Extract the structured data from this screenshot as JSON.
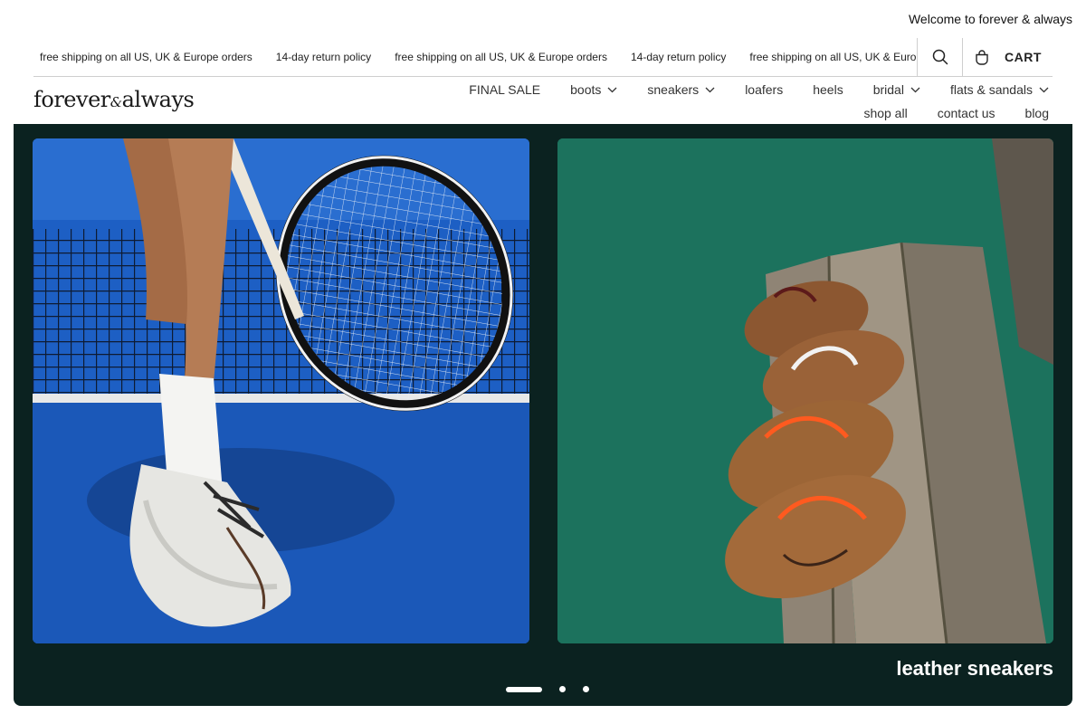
{
  "welcome": "Welcome to forever & always",
  "ticker": [
    "free shipping on all US, UK & Europe orders",
    "14-day return policy",
    "free shipping on all US, UK & Europe orders",
    "14-day return policy",
    "free shipping on all US, UK & Europe orders"
  ],
  "cart": {
    "label": "CART"
  },
  "logo": {
    "part1": "forever",
    "amp": "&",
    "part2": "always"
  },
  "nav": {
    "row1": [
      {
        "label": "FINAL SALE",
        "dropdown": false
      },
      {
        "label": "boots",
        "dropdown": true
      },
      {
        "label": "sneakers",
        "dropdown": true
      },
      {
        "label": "loafers",
        "dropdown": false
      },
      {
        "label": "heels",
        "dropdown": false
      },
      {
        "label": "bridal",
        "dropdown": true
      },
      {
        "label": "flats & sandals",
        "dropdown": true
      }
    ],
    "row2": [
      {
        "label": "shop all"
      },
      {
        "label": "contact us"
      },
      {
        "label": "blog"
      }
    ]
  },
  "hero": {
    "caption": "leather sneakers",
    "slide_count": 3,
    "active_slide": 1
  },
  "colors": {
    "hero_bg": "#0b2220",
    "court_blue": "#1f63c6",
    "court_green": "#1e7a62"
  }
}
